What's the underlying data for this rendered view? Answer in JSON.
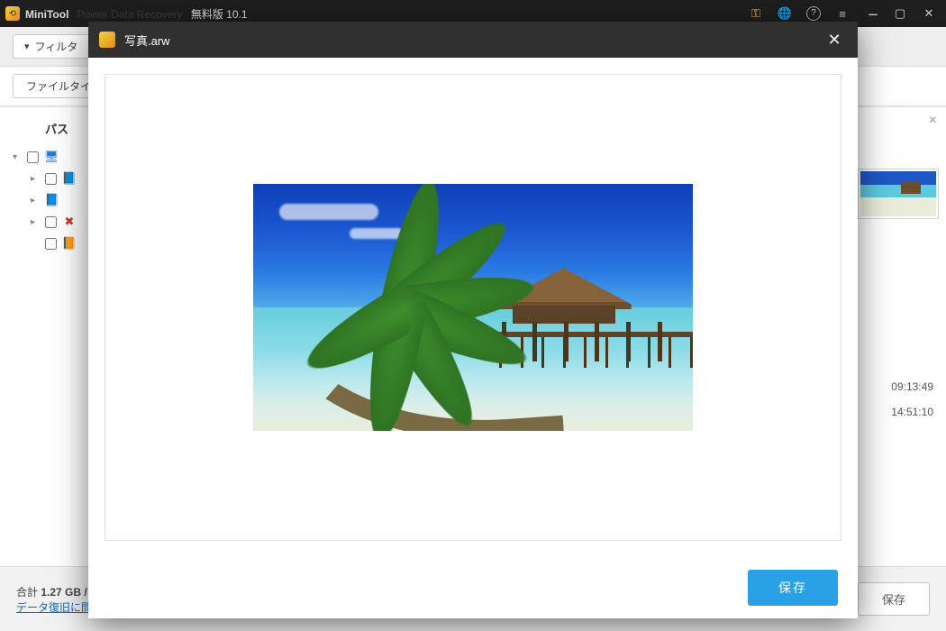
{
  "window": {
    "app_name": "MiniTool",
    "title_suffix": "無料版 10.1"
  },
  "toolbar": {
    "filter_label": "フィルタ"
  },
  "category_tabs": {
    "file_type": "ファイルタイプ"
  },
  "tree": {
    "header": "パス"
  },
  "detail": {
    "times": [
      "09:13:49",
      "14:51:10"
    ]
  },
  "status": {
    "total_prefix": "合計",
    "total_size": "1.27 GB /",
    "link": "データ復旧に問題"
  },
  "buttons": {
    "save_outline": "保存",
    "save_primary": "保存"
  },
  "modal": {
    "title": "写真.arw"
  }
}
